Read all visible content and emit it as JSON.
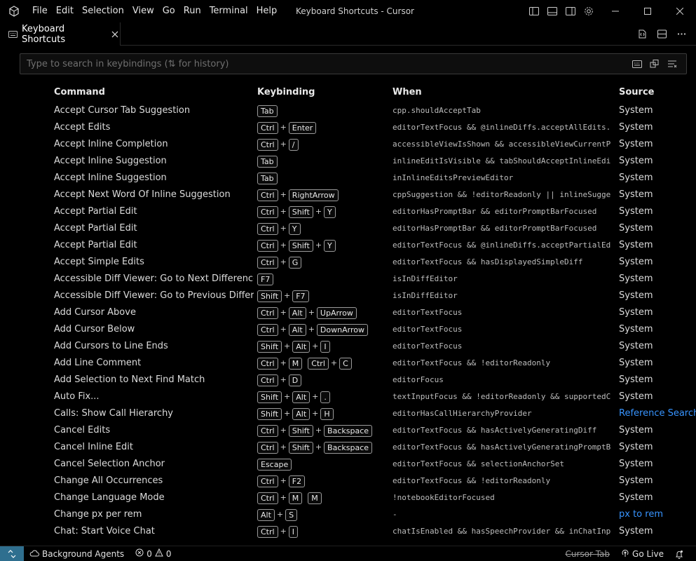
{
  "window": {
    "title": "Keyboard Shortcuts - Cursor",
    "menu": [
      "File",
      "Edit",
      "Selection",
      "View",
      "Go",
      "Run",
      "Terminal",
      "Help"
    ]
  },
  "tab": {
    "label": "Keyboard Shortcuts"
  },
  "search": {
    "placeholder": "Type to search in keybindings (⇅ for history)"
  },
  "columns": {
    "command": "Command",
    "keybinding": "Keybinding",
    "when": "When",
    "source": "Source"
  },
  "rows": [
    {
      "command": "Accept Cursor Tab Suggestion",
      "keys": [
        [
          "Tab"
        ]
      ],
      "when": "cpp.shouldAcceptTab",
      "source": "System"
    },
    {
      "command": "Accept Edits",
      "keys": [
        [
          "Ctrl",
          "Enter"
        ]
      ],
      "when": "editorTextFocus && @inlineDiffs.acceptAllEdits...",
      "source": "System"
    },
    {
      "command": "Accept Inline Completion",
      "keys": [
        [
          "Ctrl",
          "/"
        ]
      ],
      "when": "accessibleViewIsShown && accessibleViewCurrentP...",
      "source": "System"
    },
    {
      "command": "Accept Inline Suggestion",
      "keys": [
        [
          "Tab"
        ]
      ],
      "when": "inlineEditIsVisible && tabShouldAcceptInlineEdi...",
      "source": "System"
    },
    {
      "command": "Accept Inline Suggestion",
      "keys": [
        [
          "Tab"
        ]
      ],
      "when": "inInlineEditsPreviewEditor",
      "source": "System"
    },
    {
      "command": "Accept Next Word Of Inline Suggestion",
      "keys": [
        [
          "Ctrl",
          "RightArrow"
        ]
      ],
      "when": "cppSuggestion && !editorReadonly || inlineSugge...",
      "source": "System"
    },
    {
      "command": "Accept Partial Edit",
      "keys": [
        [
          "Ctrl",
          "Shift",
          "Y"
        ]
      ],
      "when": "editorHasPromptBar && editorPromptBarFocused",
      "source": "System"
    },
    {
      "command": "Accept Partial Edit",
      "keys": [
        [
          "Ctrl",
          "Y"
        ]
      ],
      "when": "editorHasPromptBar && editorPromptBarFocused",
      "source": "System"
    },
    {
      "command": "Accept Partial Edit",
      "keys": [
        [
          "Ctrl",
          "Shift",
          "Y"
        ]
      ],
      "when": "editorTextFocus && @inlineDiffs.acceptPartialEd...",
      "source": "System"
    },
    {
      "command": "Accept Simple Edits",
      "keys": [
        [
          "Ctrl",
          "G"
        ]
      ],
      "when": "editorTextFocus && hasDisplayedSimpleDiff",
      "source": "System"
    },
    {
      "command": "Accessible Diff Viewer: Go to Next Difference",
      "keys": [
        [
          "F7"
        ]
      ],
      "when": "isInDiffEditor",
      "source": "System"
    },
    {
      "command": "Accessible Diff Viewer: Go to Previous Difference",
      "keys": [
        [
          "Shift",
          "F7"
        ]
      ],
      "when": "isInDiffEditor",
      "source": "System"
    },
    {
      "command": "Add Cursor Above",
      "keys": [
        [
          "Ctrl",
          "Alt",
          "UpArrow"
        ]
      ],
      "when": "editorTextFocus",
      "source": "System"
    },
    {
      "command": "Add Cursor Below",
      "keys": [
        [
          "Ctrl",
          "Alt",
          "DownArrow"
        ]
      ],
      "when": "editorTextFocus",
      "source": "System"
    },
    {
      "command": "Add Cursors to Line Ends",
      "keys": [
        [
          "Shift",
          "Alt",
          "I"
        ]
      ],
      "when": "editorTextFocus",
      "source": "System"
    },
    {
      "command": "Add Line Comment",
      "keys": [
        [
          "Ctrl",
          "M"
        ],
        [
          "Ctrl",
          "C"
        ]
      ],
      "when": "editorTextFocus && !editorReadonly",
      "source": "System"
    },
    {
      "command": "Add Selection to Next Find Match",
      "keys": [
        [
          "Ctrl",
          "D"
        ]
      ],
      "when": "editorFocus",
      "source": "System"
    },
    {
      "command": "Auto Fix...",
      "keys": [
        [
          "Shift",
          "Alt",
          "."
        ]
      ],
      "when": "textInputFocus && !editorReadonly && supportedC...",
      "source": "System"
    },
    {
      "command": "Calls: Show Call Hierarchy",
      "keys": [
        [
          "Shift",
          "Alt",
          "H"
        ]
      ],
      "when": "editorHasCallHierarchyProvider",
      "source": "Reference Search V",
      "sourceLink": true
    },
    {
      "command": "Cancel Edits",
      "keys": [
        [
          "Ctrl",
          "Shift",
          "Backspace"
        ]
      ],
      "when": "editorTextFocus && hasActivelyGeneratingDiff",
      "source": "System"
    },
    {
      "command": "Cancel Inline Edit",
      "keys": [
        [
          "Ctrl",
          "Shift",
          "Backspace"
        ]
      ],
      "when": "editorTextFocus && hasActivelyGeneratingPromptB...",
      "source": "System"
    },
    {
      "command": "Cancel Selection Anchor",
      "keys": [
        [
          "Escape"
        ]
      ],
      "when": "editorTextFocus && selectionAnchorSet",
      "source": "System"
    },
    {
      "command": "Change All Occurrences",
      "keys": [
        [
          "Ctrl",
          "F2"
        ]
      ],
      "when": "editorTextFocus && !editorReadonly",
      "source": "System"
    },
    {
      "command": "Change Language Mode",
      "keys": [
        [
          "Ctrl",
          "M"
        ],
        [
          "M"
        ]
      ],
      "when": "!notebookEditorFocused",
      "source": "System"
    },
    {
      "command": "Change px per rem",
      "keys": [
        [
          "Alt",
          "S"
        ]
      ],
      "when": "-",
      "source": "px to rem",
      "sourceLink": true
    },
    {
      "command": "Chat: Start Voice Chat",
      "keys": [
        [
          "Ctrl",
          "I"
        ]
      ],
      "when": "chatIsEnabled && hasSpeechProvider && inChatInp...",
      "source": "System"
    }
  ],
  "status": {
    "agents": "Background Agents",
    "errors": "0",
    "warnings": "0",
    "cursor_tab": "Cursor Tab",
    "go_live": "Go Live"
  }
}
